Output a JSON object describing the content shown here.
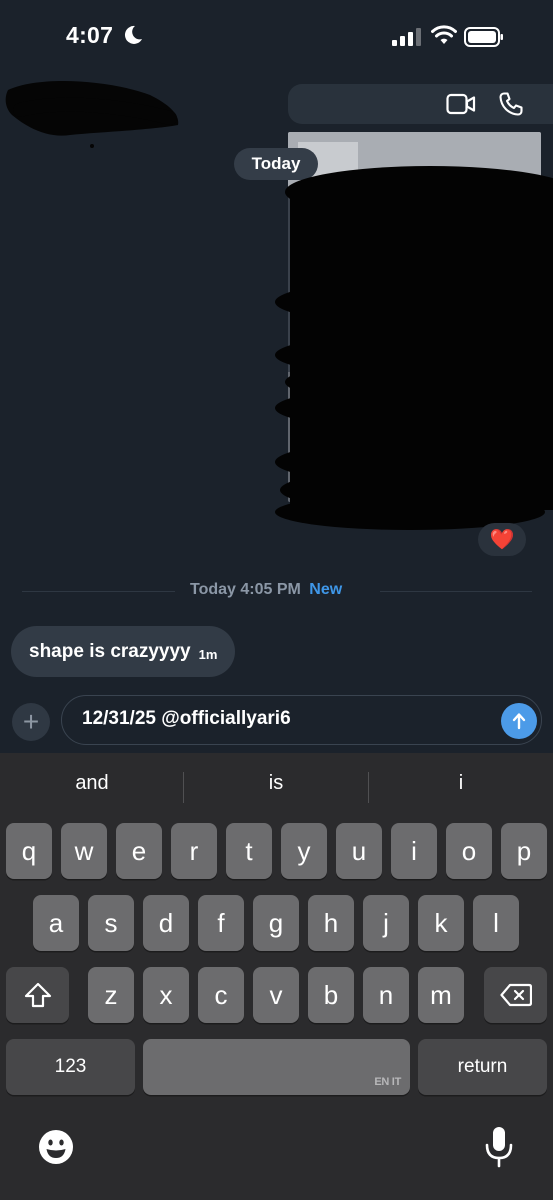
{
  "status_bar": {
    "time": "4:07"
  },
  "header": {
    "video_call_icon": "video-icon",
    "voice_call_icon": "phone-icon"
  },
  "conversation": {
    "date_pill": "Today",
    "image_reaction": "❤️",
    "unread_divider": {
      "label": "Today 4:05 PM",
      "badge": "New"
    },
    "incoming_message": {
      "text": "shape is crazyyyy",
      "time": "1m"
    }
  },
  "composer": {
    "text": "12/31/25 @officiallyari6",
    "plus_label": "+"
  },
  "keyboard": {
    "suggestions": [
      "and",
      "is",
      "i"
    ],
    "row1": [
      "q",
      "w",
      "e",
      "r",
      "t",
      "y",
      "u",
      "i",
      "o",
      "p"
    ],
    "row2": [
      "a",
      "s",
      "d",
      "f",
      "g",
      "h",
      "j",
      "k",
      "l"
    ],
    "row3": [
      "z",
      "x",
      "c",
      "v",
      "b",
      "n",
      "m"
    ],
    "numbers_label": "123",
    "return_label": "return",
    "space_languages": "EN IT"
  },
  "colors": {
    "background": "#1b222b",
    "accent": "#4c9be8",
    "new_badge": "#3f97e8"
  }
}
